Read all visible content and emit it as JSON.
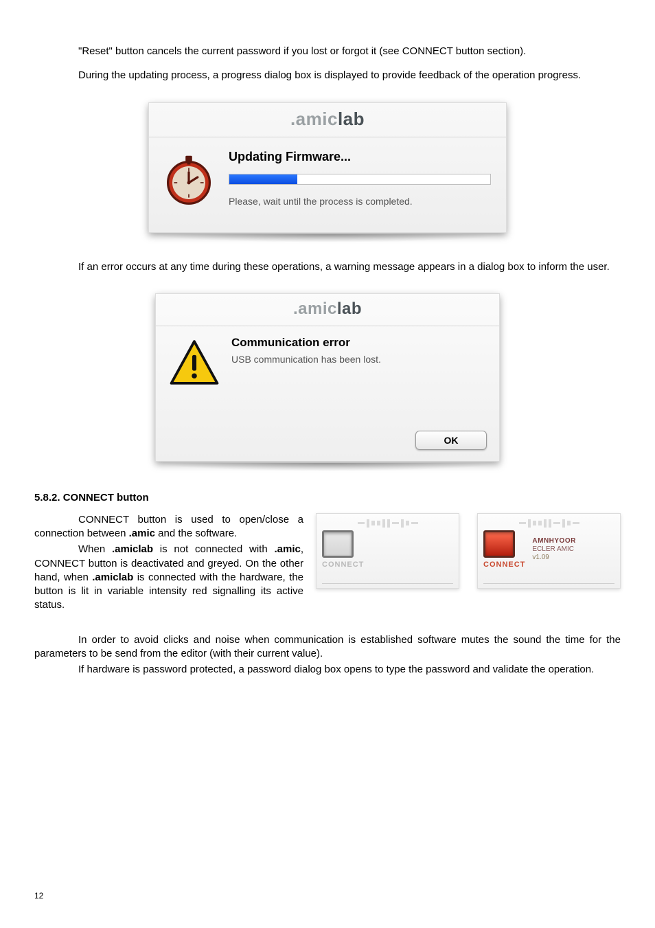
{
  "para1_a": "\"Reset\" button cancels the current password if you lost or forgot it (see CONNECT button section).",
  "para1_b": "During the updating process, a progress dialog box is displayed to provide feedback of the operation progress.",
  "brand_prefix": ".amic",
  "brand_suffix": "lab",
  "progress": {
    "title": "Updating Firmware...",
    "message": "Please, wait until the process is completed."
  },
  "para2": "If an error occurs at any time during these operations, a warning message appears in a dialog box to inform the user.",
  "error": {
    "title": "Communication error",
    "message": "USB communication has been lost.",
    "ok": "OK"
  },
  "section_heading": "5.8.2. CONNECT button",
  "sec_p1_a": "CONNECT button is used to open/close a connection between ",
  "sec_p1_amic": ".amic",
  "sec_p1_b": " and the software.",
  "sec_p2_a": "When ",
  "sec_p2_amiclab": ".amiclab",
  "sec_p2_b": " is not connected with ",
  "sec_p2_amic": ".amic",
  "sec_p2_c": ", CONNECT button is deactivated and greyed. On the other hand, when ",
  "sec_p2_amiclab2": ".amiclab",
  "sec_p2_d": " is connected with the hardware, the button is lit in variable intensity red signalling its active status.",
  "sec_p3": "In order to avoid clicks and noise when communication is established software mutes the sound the time for the parameters to be send from the editor (with their current value).",
  "sec_p4": "If hardware is password protected, a password dialog box opens to type the password and validate the operation.",
  "conn": {
    "label": "CONNECT",
    "device_line1": "AMNHYOOR",
    "device_line2": "ECLER AMIC",
    "device_line3": "v1.09"
  },
  "page_number": "12"
}
